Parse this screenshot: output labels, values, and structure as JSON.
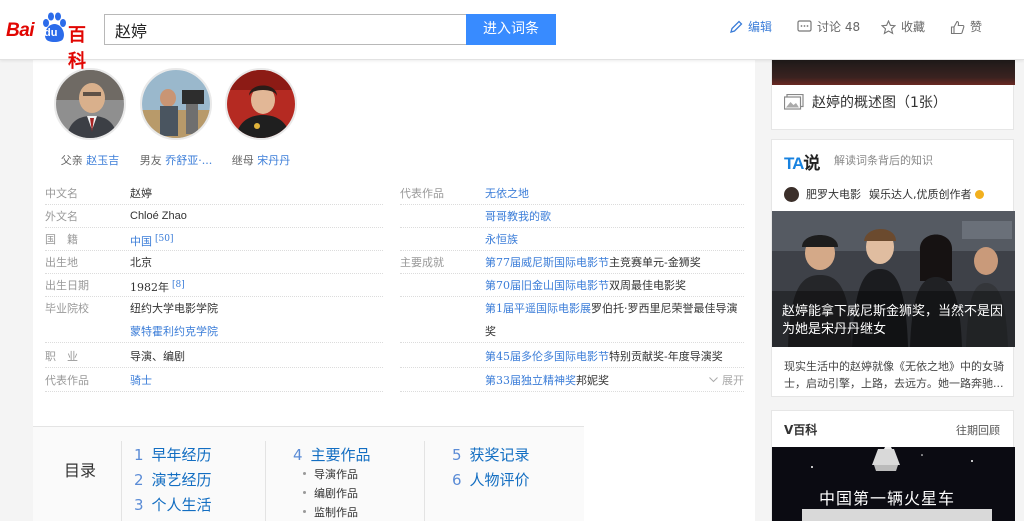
{
  "header": {
    "logo_bai": "Bai",
    "logo_du": "du",
    "logo_baike": "百科",
    "search_value": "赵婷",
    "search_button": "进入词条",
    "tools": {
      "edit": "编辑",
      "discuss": "讨论 48",
      "collect": "收藏",
      "like": "赞"
    }
  },
  "relations": [
    {
      "role": "父亲",
      "name": "赵玉吉"
    },
    {
      "role": "男友",
      "name": "乔舒亚·..."
    },
    {
      "role": "继母",
      "name": "宋丹丹"
    }
  ],
  "info": {
    "left": [
      {
        "key": "中文名",
        "value": "赵婷"
      },
      {
        "key": "外文名",
        "value": "Chloé Zhao"
      },
      {
        "key": "国　籍",
        "value": "中国",
        "ref": "[50]"
      },
      {
        "key": "出生地",
        "value": "北京"
      },
      {
        "key": "出生日期",
        "value": "1982年",
        "ref": "[8]"
      },
      {
        "key": "毕业院校",
        "value": "纽约大学电影学院",
        "value2": "蒙特霍利约克学院"
      },
      {
        "key": "职　业",
        "value": "导演、编剧"
      },
      {
        "key": "代表作品",
        "value": "骑士"
      }
    ],
    "right": {
      "works_key": "代表作品",
      "works": [
        "无依之地",
        "哥哥教我的歌",
        "永恒族"
      ],
      "awards_key": "主要成就",
      "awards": [
        {
          "num": "第77",
          "festival": "届威尼斯国际电影节",
          "prize": "主竞赛单元-金狮奖"
        },
        {
          "num": "第70",
          "festival": "届旧金山国际电影节",
          "prize": "双周最佳电影奖"
        },
        {
          "num": "第1",
          "festival": "届平遥国际电影展",
          "prize": "罗伯托·罗西里尼荣誉最佳导演",
          "prize2": "奖"
        },
        {
          "num": "第45",
          "festival": "届多伦多国际电影节",
          "prize": "特别贡献奖-年度导演奖"
        },
        {
          "num": "第33",
          "festival": "届独立精神奖",
          "prize": "邦妮奖"
        }
      ],
      "expand": "展开"
    }
  },
  "toc": {
    "title": "目录",
    "items": [
      {
        "num": "1",
        "label": "早年经历"
      },
      {
        "num": "2",
        "label": "演艺经历"
      },
      {
        "num": "3",
        "label": "个人生活"
      },
      {
        "num": "4",
        "label": "主要作品"
      },
      {
        "num": "5",
        "label": "获奖记录"
      },
      {
        "num": "6",
        "label": "人物评价"
      }
    ],
    "subs": [
      "导演作品",
      "编剧作品",
      "监制作品"
    ]
  },
  "side": {
    "overview_label": "赵婷的概述图（1张）",
    "ta_logo_a": "TA",
    "ta_logo_b": "说",
    "ta_desc": "解读词条背后的知识",
    "ta_author": "肥罗大电影",
    "ta_author_tag": "娱乐达人,优质创作者",
    "ta_photo_title": "赵婷能拿下威尼斯金狮奖，当然不是因为她是宋丹丹继女",
    "ta_text": "现实生活中的赵婷就像《无依之地》中的女骑士，启动引擎，上路，去远方。她一路奔驰...",
    "v_title": "V百科",
    "v_link": "往期回顾",
    "v_img_text": "中国第一辆火星车",
    "colors": {
      "accent": "#388bff",
      "link": "#3b7dd8",
      "brand": "#e10602"
    }
  }
}
